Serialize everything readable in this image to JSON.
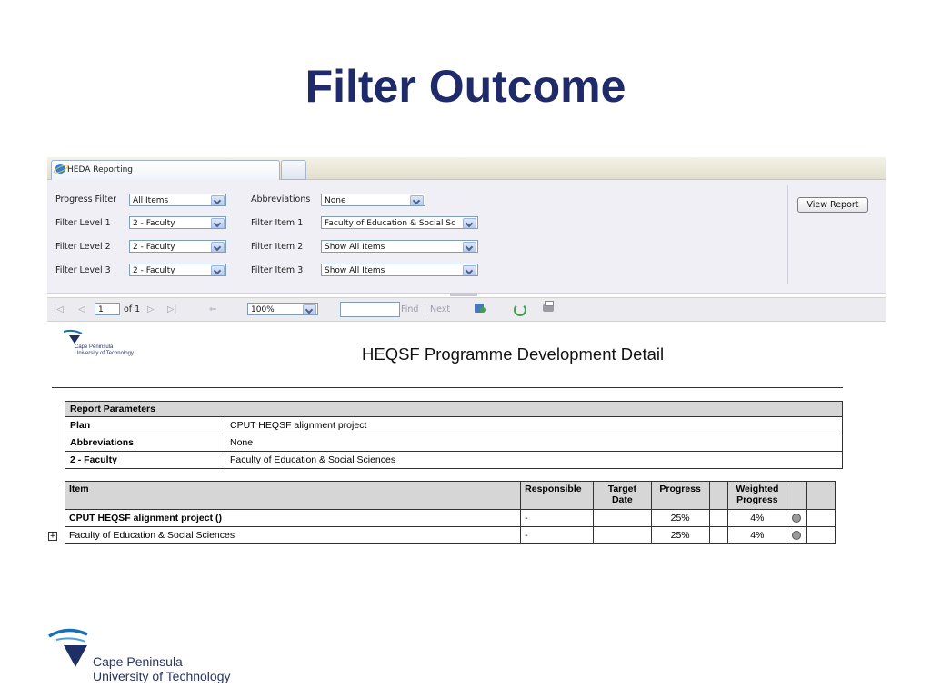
{
  "slide": {
    "title": "Filter Outcome"
  },
  "browser": {
    "tab_title": "HEDA Reporting"
  },
  "filters": {
    "progress_filter": {
      "label": "Progress Filter",
      "value": "All Items"
    },
    "abbreviations": {
      "label": "Abbreviations",
      "value": "None"
    },
    "level1": {
      "label": "Filter Level 1",
      "value": "2 - Faculty"
    },
    "item1": {
      "label": "Filter Item 1",
      "value": "Faculty of Education & Social Sc"
    },
    "level2": {
      "label": "Filter Level 2",
      "value": "2 - Faculty"
    },
    "item2": {
      "label": "Filter Item 2",
      "value": "Show All Items"
    },
    "level3": {
      "label": "Filter Level 3",
      "value": "2 - Faculty"
    },
    "item3": {
      "label": "Filter Item 3",
      "value": "Show All Items"
    },
    "view_report": "View Report"
  },
  "toolbar": {
    "first": "|◁",
    "prev": "◁",
    "page": "1",
    "of": "of 1",
    "next": "▷",
    "last": "▷|",
    "back": "⇦",
    "zoom": "100%",
    "find": "Find",
    "sep": "|",
    "next_link": "Next"
  },
  "report": {
    "logo_small_line1": "Cape Peninsula",
    "logo_small_line2": "University of Technology",
    "title": "HEQSF Programme Development Detail",
    "params_header": "Report Parameters",
    "params": [
      {
        "key": "Plan",
        "value": "CPUT HEQSF alignment project"
      },
      {
        "key": "Abbreviations",
        "value": "None"
      },
      {
        "key": "2 - Faculty",
        "value": "Faculty of Education & Social Sciences"
      }
    ],
    "columns": {
      "item": "Item",
      "responsible": "Responsible",
      "target": "Target Date",
      "progress": "Progress",
      "weighted": "Weighted Progress"
    },
    "rows": [
      {
        "item": "CPUT HEQSF alignment project ()",
        "responsible": "-",
        "target": "",
        "progress": "25%",
        "weighted": "4%"
      },
      {
        "item": "Faculty of Education & Social Sciences",
        "responsible": "-",
        "target": "",
        "progress": "25%",
        "weighted": "4%"
      }
    ],
    "expander": "+"
  },
  "footer": {
    "line1": "Cape Peninsula",
    "line2": "University of Technology"
  },
  "colors": {
    "title": "#1f2a6b",
    "params_bg": "#f0eff5",
    "header_bg": "#d6d6d6"
  }
}
